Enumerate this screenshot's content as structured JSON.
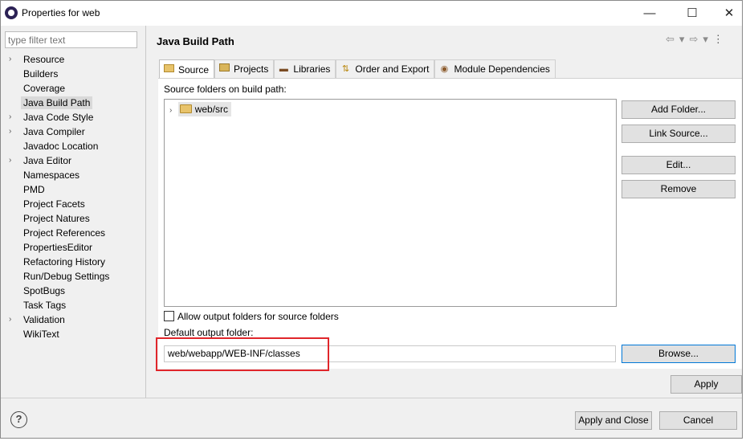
{
  "window": {
    "title": "Properties for web",
    "minimize_glyph": "—",
    "maximize_glyph": "☐",
    "close_glyph": "✕"
  },
  "filter": {
    "placeholder": "type filter text"
  },
  "tree": {
    "items": [
      {
        "label": "Resource",
        "expandable": true
      },
      {
        "label": "Builders",
        "expandable": false
      },
      {
        "label": "Coverage",
        "expandable": false
      },
      {
        "label": "Java Build Path",
        "expandable": false,
        "selected": true
      },
      {
        "label": "Java Code Style",
        "expandable": true
      },
      {
        "label": "Java Compiler",
        "expandable": true
      },
      {
        "label": "Javadoc Location",
        "expandable": false
      },
      {
        "label": "Java Editor",
        "expandable": true
      },
      {
        "label": "Namespaces",
        "expandable": false
      },
      {
        "label": "PMD",
        "expandable": false
      },
      {
        "label": "Project Facets",
        "expandable": false
      },
      {
        "label": "Project Natures",
        "expandable": false
      },
      {
        "label": "Project References",
        "expandable": false
      },
      {
        "label": "PropertiesEditor",
        "expandable": false
      },
      {
        "label": "Refactoring History",
        "expandable": false
      },
      {
        "label": "Run/Debug Settings",
        "expandable": false
      },
      {
        "label": "SpotBugs",
        "expandable": false
      },
      {
        "label": "Task Tags",
        "expandable": false
      },
      {
        "label": "Validation",
        "expandable": true
      },
      {
        "label": "WikiText",
        "expandable": false
      }
    ]
  },
  "page": {
    "title": "Java Build Path",
    "nav": {
      "back": "⇦",
      "back_menu": "▾",
      "forward": "⇨",
      "forward_menu": "▾",
      "more": "⋮"
    }
  },
  "tabs": [
    {
      "label": "Source",
      "icon": "source-folder-icon",
      "active": true
    },
    {
      "label": "Projects",
      "icon": "projects-icon",
      "active": false
    },
    {
      "label": "Libraries",
      "icon": "libraries-icon",
      "active": false
    },
    {
      "label": "Order and Export",
      "icon": "order-export-icon",
      "active": false
    },
    {
      "label": "Module Dependencies",
      "icon": "module-icon",
      "active": false
    }
  ],
  "source_tab": {
    "section_label": "Source folders on build path:",
    "folders": [
      {
        "label": "web/src",
        "icon": "source-folder-icon"
      }
    ],
    "buttons": {
      "add_folder": "Add Folder...",
      "link_source": "Link Source...",
      "edit": "Edit...",
      "remove": "Remove"
    },
    "allow_output_label": "Allow output folders for source folders",
    "allow_output_checked": false,
    "default_output_label": "Default output folder:",
    "default_output_value": "web/webapp/WEB-INF/classes",
    "browse": "Browse..."
  },
  "footer": {
    "apply": "Apply",
    "apply_close": "Apply and Close",
    "cancel": "Cancel",
    "help": "?"
  },
  "colors": {
    "highlight_box": "#e0262b",
    "focus_border": "#0078d7",
    "dialog_bg": "#f0f0f0"
  }
}
